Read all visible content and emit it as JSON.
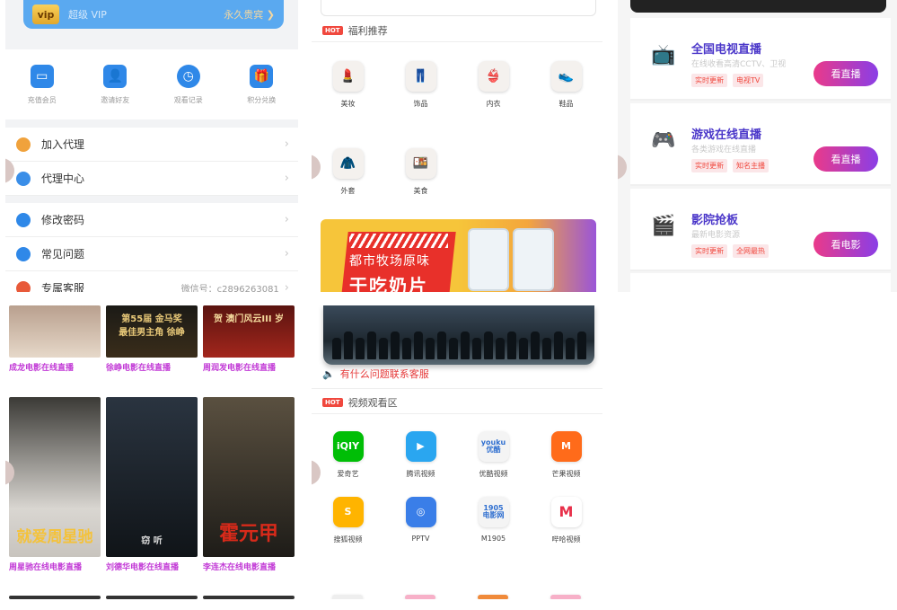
{
  "userCenter": {
    "vip": {
      "badge": "vip",
      "label": "超级 VIP",
      "forever": "永久贵宾 ❯"
    },
    "quick": [
      {
        "label": "充值会员",
        "icon": "card-icon",
        "glyph": "▭"
      },
      {
        "label": "邀请好友",
        "icon": "user-icon",
        "glyph": "👤"
      },
      {
        "label": "观看记录",
        "icon": "clock-icon",
        "glyph": "◷"
      },
      {
        "label": "积分兑换",
        "icon": "gift-icon",
        "glyph": "🎁"
      }
    ],
    "menu1": [
      {
        "label": "加入代理",
        "icon": "agent-icon",
        "color": "#f0a23c"
      },
      {
        "label": "代理中心",
        "icon": "agent-center-icon",
        "color": "#3a8ee8"
      }
    ],
    "menu2": [
      {
        "label": "修改密码",
        "icon": "lock-icon",
        "color": "#2f88e8"
      },
      {
        "label": "常见问题",
        "icon": "question-icon",
        "color": "#2f88e8"
      },
      {
        "label": "专属客服",
        "icon": "service-icon",
        "color": "#e85a3a",
        "extra": "微信号：c2896263081"
      }
    ],
    "chevron": "›"
  },
  "welfare": {
    "section": "福利推荐",
    "hot": "HOT",
    "items": [
      {
        "label": "美妆",
        "glyph": "💄"
      },
      {
        "label": "饰品",
        "glyph": "👖"
      },
      {
        "label": "内衣",
        "glyph": "👙"
      },
      {
        "label": "鞋品",
        "glyph": "👟"
      },
      {
        "label": "外套",
        "glyph": "🧥"
      },
      {
        "label": "美食",
        "glyph": "🍱"
      }
    ],
    "banner": {
      "line1": "都市牧场原味",
      "line2": "干吃奶片"
    }
  },
  "live": {
    "cards": [
      {
        "title": "全国电视直播",
        "desc": "在线收看高清CCTV、卫视",
        "tags": [
          "实时更新",
          "电视TV"
        ],
        "button": "看直播",
        "icon": "tv-icon",
        "glyph": "📺",
        "color": "#e8304a"
      },
      {
        "title": "游戏在线直播",
        "desc": "各类游戏在线直播",
        "tags": [
          "实时更新",
          "知名主播"
        ],
        "button": "看直播",
        "icon": "game-icon",
        "glyph": "🎮",
        "color": "#e8304a"
      },
      {
        "title": "影院抢板",
        "desc": "最新电影资源",
        "tags": [
          "实时更新",
          "全网最热"
        ],
        "button": "看电影",
        "icon": "cinema-icon",
        "glyph": "🎬",
        "color": "#5a3ad6"
      }
    ]
  },
  "movies": {
    "row1": [
      {
        "caption": "成龙电影在线直播",
        "overlay": ""
      },
      {
        "caption": "徐峥电影在线直播",
        "overlay": "第55届 金马奖\n最佳男主角 徐峥"
      },
      {
        "caption": "周润发电影在线直播",
        "overlay": "贺 澳门风云III 岁"
      }
    ],
    "row2": [
      {
        "caption": "周星驰在线电影直播",
        "overlay": "就爱周星驰"
      },
      {
        "caption": "刘德华电影在线直播",
        "overlay": "窃 听"
      },
      {
        "caption": "李连杰在线电影直播",
        "overlay": "霍元甲"
      }
    ]
  },
  "videoZone": {
    "notice": "有什么问题联系客服",
    "section": "视频观看区",
    "hot": "HOT",
    "apps": [
      {
        "label": "爱奇艺",
        "logo": "iQIY",
        "color": "#00be06"
      },
      {
        "label": "腾讯视频",
        "logo": "▶",
        "color": "#2aa6f0"
      },
      {
        "label": "优酷视频",
        "logo": "youku\n优酷",
        "color": "#f4f4f4"
      },
      {
        "label": "芒果视频",
        "logo": "M",
        "color": "#ff6b1a"
      },
      {
        "label": "搜狐视频",
        "logo": "S",
        "color": "#ffb400"
      },
      {
        "label": "PPTV",
        "logo": "◎",
        "color": "#3a7ee8"
      },
      {
        "label": "M1905",
        "logo": "1905\n电影网",
        "color": "#f4f4f4"
      },
      {
        "label": "哔哈视频",
        "logo": "M",
        "color": "#ffffff"
      }
    ]
  }
}
